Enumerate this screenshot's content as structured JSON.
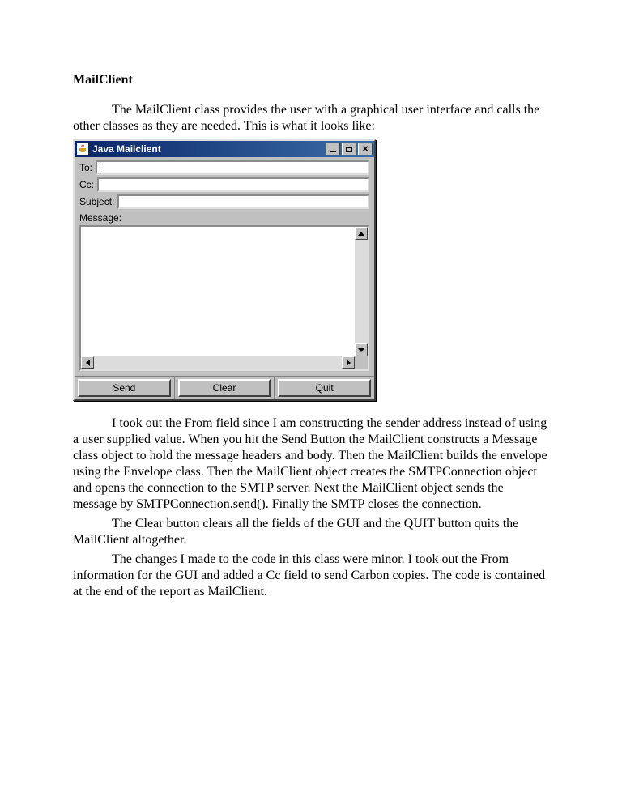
{
  "heading": "MailClient",
  "intro": "The MailClient class provides the user with a graphical user interface and calls the other classes as they are needed.  This is what it looks like:",
  "window": {
    "title": "Java Mailclient",
    "labels": {
      "to": "To:",
      "cc": "Cc:",
      "subject": "Subject:",
      "message": "Message:"
    },
    "values": {
      "to": "",
      "cc": "",
      "subject": "",
      "message": ""
    },
    "buttons": {
      "send": "Send",
      "clear": "Clear",
      "quit": "Quit"
    }
  },
  "body": {
    "p1": "I took out the From field since I am constructing the sender address instead of using a user supplied value.    When you hit the Send Button the MailClient constructs a Message class object to hold the message headers and body.  Then the MailClient builds the envelope using the Envelope class.  Then the MailClient  object creates the SMTPConnection object and opens the connection to the SMTP server.  Next the MailClient object sends the message by SMTPConnection.send().  Finally the SMTP closes the connection.",
    "p2": "The Clear button clears all the fields of the GUI and the QUIT button quits the MailClient altogether.",
    "p3": "The changes I made to the code in this class were minor.  I took out the From information for the GUI and added a Cc field to send Carbon copies.  The code is contained at the end of the report  as MailClient."
  }
}
